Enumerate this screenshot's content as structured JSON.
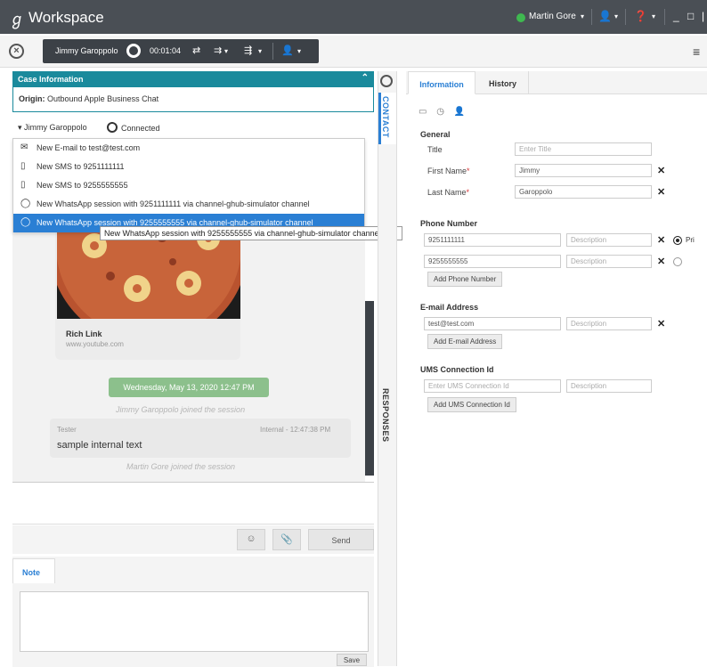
{
  "titlebar": {
    "app_title": "Workspace",
    "agent_name": "Martin Gore",
    "colors": {
      "bar": "#4a4f55",
      "status_ready": "#3fb950"
    }
  },
  "interaction": {
    "contact_name": "Jimmy Garoppolo",
    "timer": "00:01:04"
  },
  "case": {
    "header": "Case Information",
    "origin_label": "Origin:",
    "origin_value": "Outbound Apple Business Chat"
  },
  "participant": {
    "name": "Jimmy Garoppolo",
    "status": "Connected"
  },
  "menu": {
    "items": [
      {
        "icon": "envelope-icon",
        "label": "New E-mail to test@test.com"
      },
      {
        "icon": "mobile-phone-icon",
        "label": "New SMS to 9251111111"
      },
      {
        "icon": "mobile-phone-icon",
        "label": "New SMS to 9255555555"
      },
      {
        "icon": "whatsapp-icon",
        "label": "New WhatsApp session with 9251111111 via channel-ghub-simulator channel"
      },
      {
        "icon": "whatsapp-icon",
        "label": "New WhatsApp session with 9255555555 via channel-ghub-simulator channel"
      }
    ],
    "tooltip": "New WhatsApp session with 9255555555 via channel-ghub-simulator channel"
  },
  "transcript": {
    "rich_link_title": "Rich Link",
    "rich_link_url": "www.youtube.com",
    "date_chip": "Wednesday, May 13, 2020 12:47 PM",
    "joined_1": "Jimmy Garoppolo joined the session",
    "note_sender": "Tester",
    "note_meta": "Internal - 12:47:38 PM",
    "note_text": "sample internal text",
    "joined_2": "Martin Gore joined the session"
  },
  "vertical_tabs": {
    "contact": "CONTACT",
    "responses": "RESPONSES"
  },
  "compose": {
    "send_label": "Send"
  },
  "note": {
    "tab_label": "Note",
    "save_label": "Save"
  },
  "contact_panel": {
    "tabs": [
      "Information",
      "History"
    ],
    "general_title": "General",
    "title_label": "Title",
    "title_placeholder": "Enter Title",
    "first_name_label": "First Name",
    "first_name_value": "Jimmy",
    "last_name_label": "Last Name",
    "last_name_value": "Garoppolo",
    "phone_title": "Phone Number",
    "phones": [
      {
        "number": "9251111111",
        "description_placeholder": "Description",
        "primary": true
      },
      {
        "number": "9255555555",
        "description_placeholder": "Description",
        "primary": false
      }
    ],
    "primary_label": "Pri",
    "add_phone": "Add Phone Number",
    "email_title": "E-mail Address",
    "email_value": "test@test.com",
    "email_description_placeholder": "Description",
    "add_email": "Add E-mail Address",
    "ums_title": "UMS Connection Id",
    "ums_placeholder": "Enter UMS Connection Id",
    "ums_description_placeholder": "Description",
    "add_ums": "Add UMS Connection Id"
  }
}
